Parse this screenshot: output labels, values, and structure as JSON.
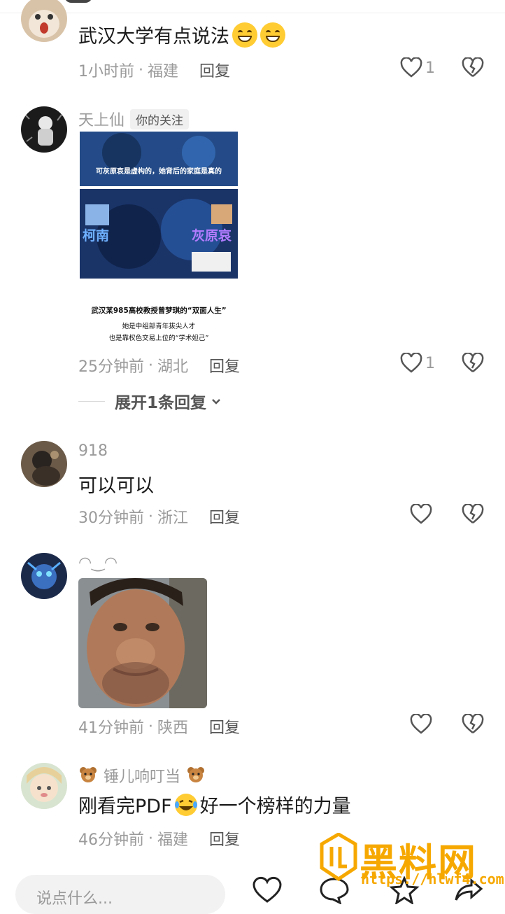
{
  "comments": [
    {
      "text": "武汉大学有点说法",
      "time": "1小时前",
      "location": "福建",
      "reply_label": "回复",
      "likes": "1"
    },
    {
      "username": "天上仙",
      "follow_tag": "你的关注",
      "image": {
        "headline": "可灰原哀是虚构的，她背后的家庭是真的",
        "left_name": "柯南",
        "right_name": "灰原哀",
        "line1": "武汉某985高校教授曾梦琪的“双面人生”",
        "line2": "她是中组部青年拔尖人才",
        "line3": "也是靠权色交易上位的“学术妲己”"
      },
      "time": "25分钟前",
      "location": "湖北",
      "reply_label": "回复",
      "likes": "1",
      "expand_label": "展开1条回复"
    },
    {
      "username": "918",
      "text": "可以可以",
      "time": "30分钟前",
      "location": "浙江",
      "reply_label": "回复"
    },
    {
      "username": "◠‿◠",
      "time": "41分钟前",
      "location": "陕西",
      "reply_label": "回复"
    },
    {
      "username": "锤儿响叮当",
      "text_before": "刚看完PDF",
      "text_after": "好一个榜样的力量",
      "time": "46分钟前",
      "location": "福建",
      "reply_label": "回复"
    }
  ],
  "bottom_bar": {
    "input_placeholder": "说点什么..."
  },
  "watermark": {
    "text": "黑料网",
    "url": "https://hlwf4.com"
  },
  "colors": {
    "meta": "#9a9a9a",
    "text": "#1a1a1a",
    "watermark": "#f6a800"
  },
  "separator": "·"
}
